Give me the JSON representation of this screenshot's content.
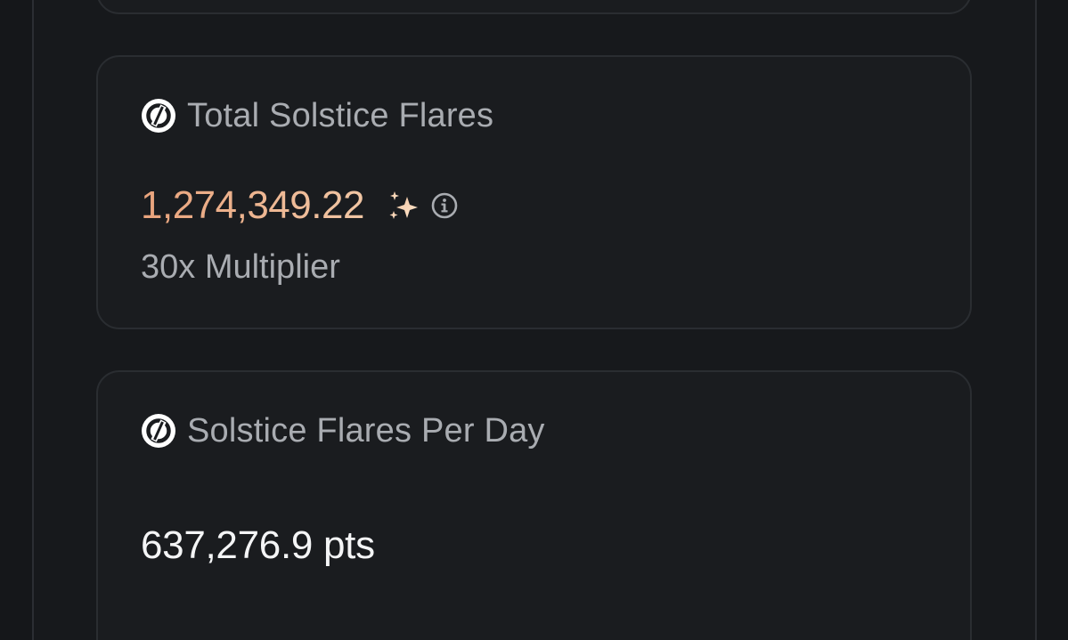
{
  "colors": {
    "background": "#15171a",
    "card_background": "#1a1c1f",
    "card_border": "#2a2d31",
    "muted_text": "#a9acb1",
    "accent_gradient_start": "#e9a37c",
    "accent_gradient_end": "#f1c6a4",
    "primary_text": "#f4f5f6"
  },
  "total_card": {
    "icon": "solstice-logo-icon",
    "title": "Total Solstice Flares",
    "value": "1,274,349.22",
    "value_icons": [
      "sparkle-icon",
      "info-icon"
    ],
    "multiplier": "30x Multiplier"
  },
  "per_day_card": {
    "icon": "solstice-logo-icon",
    "title": "Solstice Flares Per Day",
    "value": "637,276.9 pts"
  }
}
